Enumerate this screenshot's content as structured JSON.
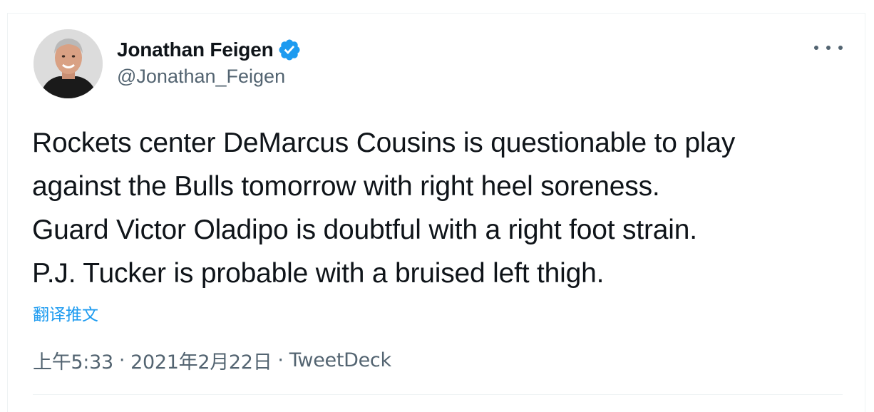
{
  "author": {
    "display_name": "Jonathan Feigen",
    "handle": "@Jonathan_Feigen",
    "verified": true,
    "avatar_icon": "profile-photo"
  },
  "tweet": {
    "text": "Rockets center DeMarcus Cousins is questionable to play\nagainst the Bulls tomorrow with right heel soreness.\nGuard Victor Oladipo is doubtful with a right foot strain.\nP.J. Tucker is probable with a bruised left thigh.",
    "translate_label": "翻译推文"
  },
  "meta": {
    "time": "上午5:33",
    "separator": "·",
    "date": "2021年2月22日",
    "source": "TweetDeck"
  },
  "colors": {
    "accent": "#1d9bf0",
    "text": "#0f1419",
    "secondary": "#536471"
  }
}
